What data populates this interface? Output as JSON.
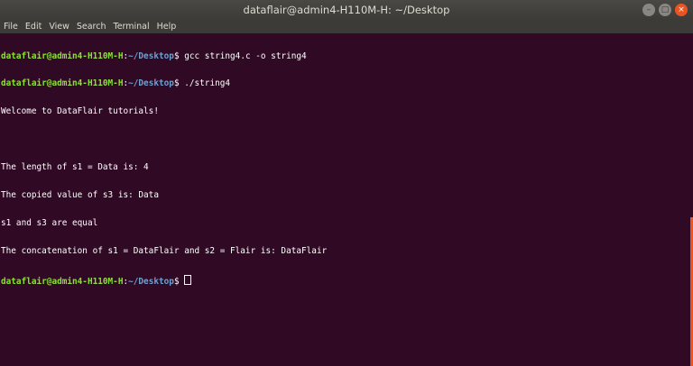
{
  "window": {
    "title": "dataflair@admin4-H110M-H: ~/Desktop",
    "controls": {
      "minimize": "–",
      "maximize": "□",
      "close": "×"
    }
  },
  "menu": {
    "items": [
      "File",
      "Edit",
      "View",
      "Search",
      "Terminal",
      "Help"
    ]
  },
  "terminal": {
    "prompt_user": "dataflair@admin4-H110M-H",
    "prompt_sep": ":",
    "prompt_path": "~/Desktop",
    "prompt_symbol": "$ ",
    "commands": [
      "gcc string4.c -o string4",
      "./string4"
    ],
    "output": [
      "Welcome to DataFlair tutorials!",
      "",
      "The length of s1 = Data is: 4",
      "The copied value of s3 is: Data",
      "s1 and s3 are equal",
      "The concatenation of s1 = DataFlair and s2 = Flair is: DataFlair"
    ]
  },
  "colors": {
    "background": "#300a24",
    "prompt_user": "#8ae234",
    "prompt_path": "#729fcf",
    "accent": "#e95420"
  }
}
